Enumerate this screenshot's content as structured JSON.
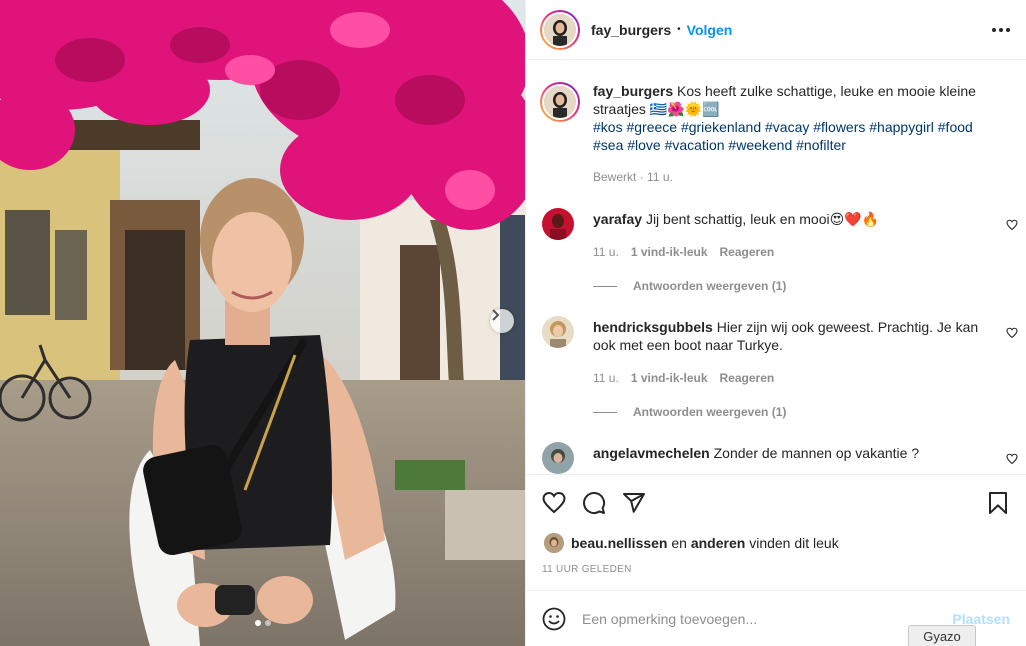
{
  "post": {
    "username": "fay_burgers",
    "separator": "•",
    "follow_label": "Volgen",
    "more_icon": "more-horizontal-icon"
  },
  "caption": {
    "username": "fay_burgers",
    "text": "Kos heeft zulke schattige, leuke en mooie kleine straatjes 🇬🇷🌺🌞🆒",
    "hashtags": "#kos #greece #griekenland #vacay #flowers #happygirl #food #sea #love #vacation #weekend #nofilter",
    "edited_label": "Bewerkt",
    "time": "11 u."
  },
  "comments": [
    {
      "username": "yarafay",
      "text": "Jij bent schattig, leuk en mooi😍❤️🔥",
      "time": "11 u.",
      "likes": "1 vind-ik-leuk",
      "reply_label": "Reageren",
      "view_replies": "Antwoorden weergeven (1)"
    },
    {
      "username": "hendricksgubbels",
      "text": "Hier zijn wij ook geweest. Prachtig. Je kan ook met een boot naar Turkye.",
      "time": "11 u.",
      "likes": "1 vind-ik-leuk",
      "reply_label": "Reageren",
      "view_replies": "Antwoorden weergeven (1)"
    },
    {
      "username": "angelavmechelen",
      "text": "Zonder de mannen op vakantie ?"
    }
  ],
  "liked_by": {
    "user": "beau.nellissen",
    "connector": "en",
    "others": "anderen",
    "suffix": "vinden dit leuk"
  },
  "timestamp": "11 UUR GELEDEN",
  "add_comment": {
    "placeholder": "Een opmerking toevoegen...",
    "post_label": "Plaatsen"
  },
  "overlay": {
    "gyazo_label": "Gyazo"
  },
  "carousel": {
    "slide_count": 2,
    "active_index": 0
  },
  "colors": {
    "accent": "#0095f6",
    "hashtag": "#00376b",
    "muted": "#8e8e8e",
    "border": "#efefef",
    "bougainvillea": "#e0137a"
  }
}
